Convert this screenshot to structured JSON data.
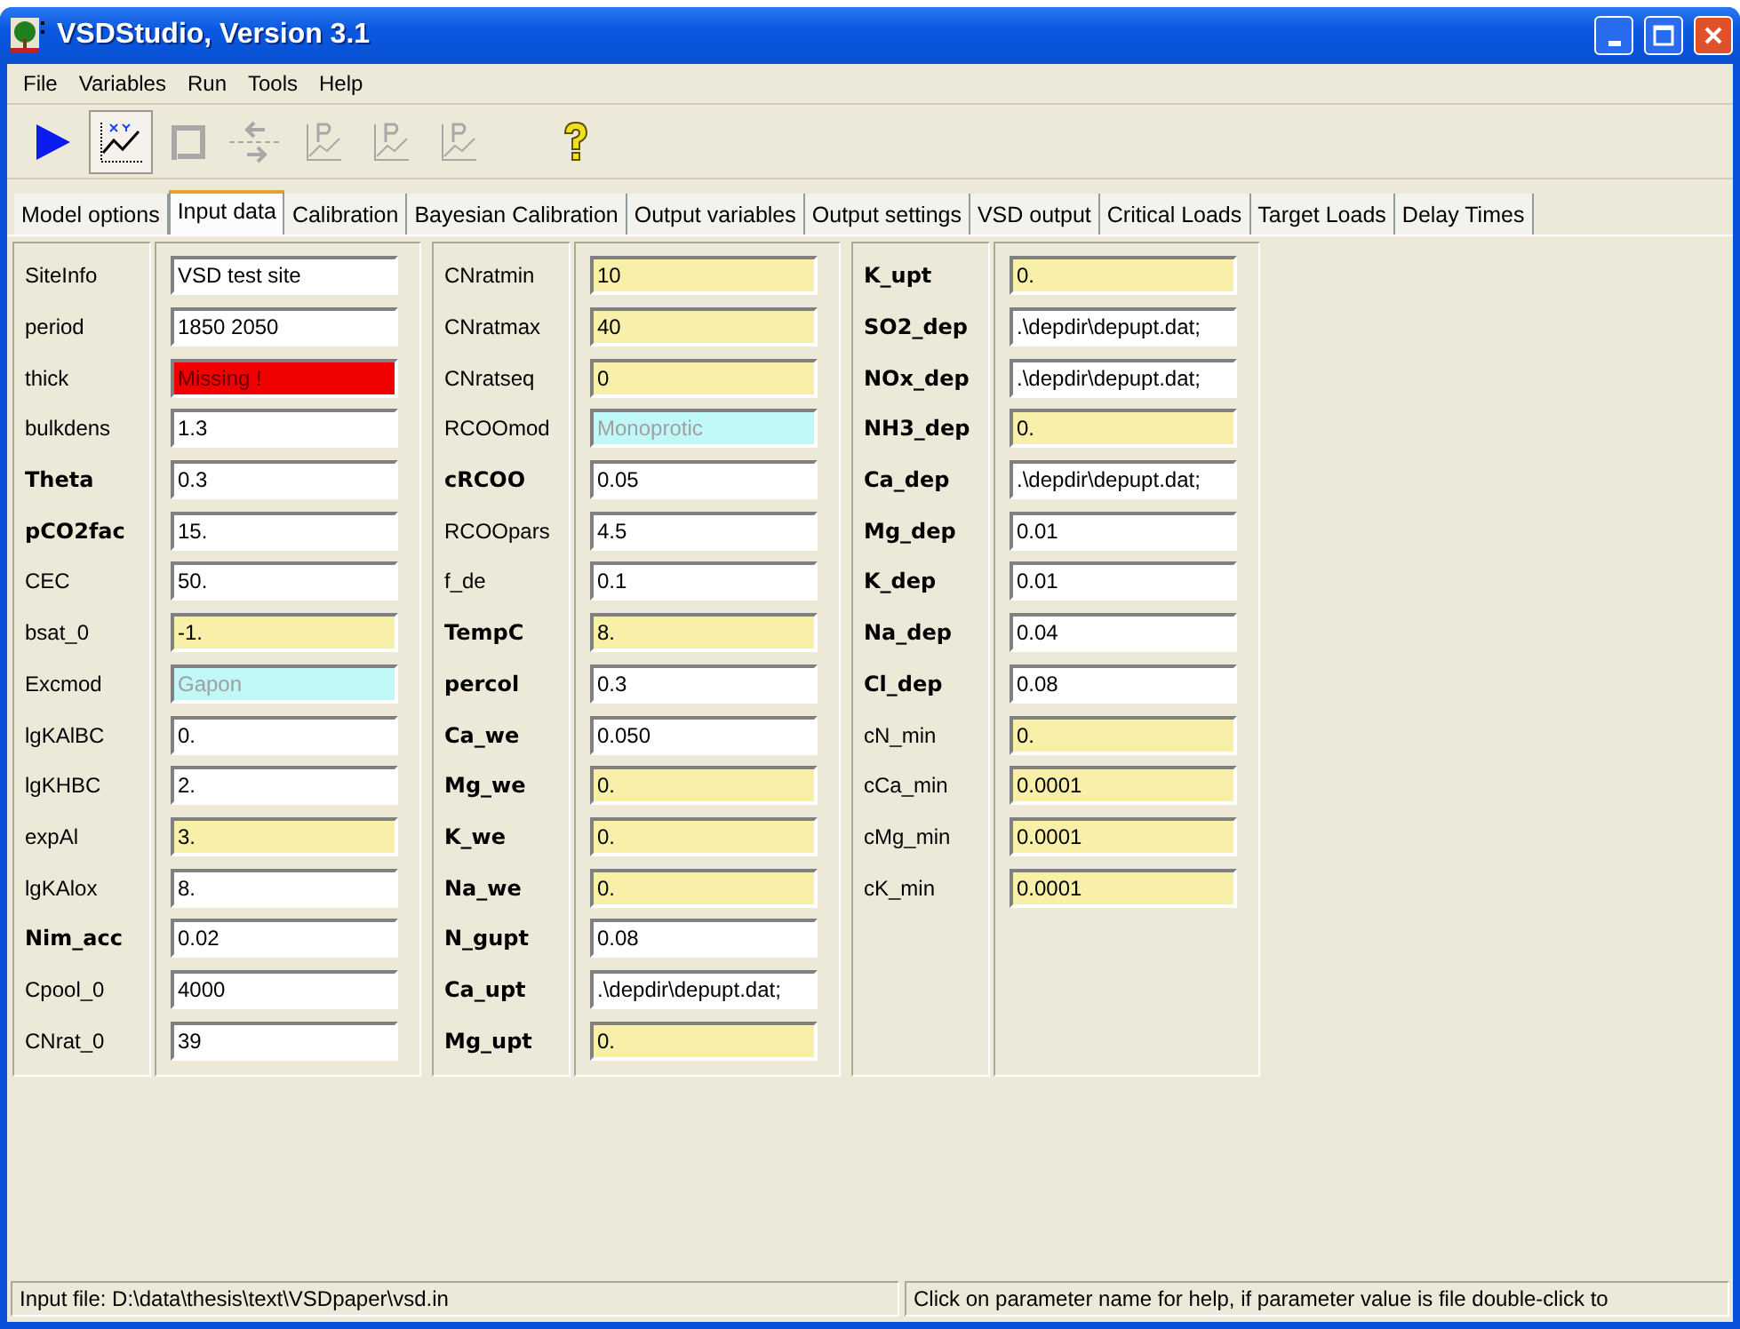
{
  "window": {
    "title": "VSDStudio, Version 3.1"
  },
  "menu": [
    {
      "label": "File"
    },
    {
      "label": "Variables"
    },
    {
      "label": "Run"
    },
    {
      "label": "Tools"
    },
    {
      "label": "Help"
    }
  ],
  "toolbar": [
    {
      "kind": "run",
      "disabled": false,
      "pressed": false
    },
    {
      "kind": "xy-plot",
      "disabled": false,
      "pressed": true
    },
    {
      "kind": "loop",
      "disabled": true,
      "pressed": false
    },
    {
      "kind": "exchange",
      "disabled": true,
      "pressed": false
    },
    {
      "kind": "plot-p",
      "disabled": true,
      "pressed": false
    },
    {
      "kind": "plot-s",
      "disabled": true,
      "pressed": false
    },
    {
      "kind": "plot-c",
      "disabled": true,
      "pressed": false
    },
    {
      "kind": "help",
      "disabled": false,
      "pressed": false
    }
  ],
  "tabs": [
    {
      "label": "Model options",
      "selected": false
    },
    {
      "label": "Input data",
      "selected": true
    },
    {
      "label": "Calibration",
      "selected": false
    },
    {
      "label": "Bayesian Calibration",
      "selected": false
    },
    {
      "label": "Output variables",
      "selected": false
    },
    {
      "label": "Output settings",
      "selected": false
    },
    {
      "label": "VSD output",
      "selected": false
    },
    {
      "label": "Critical Loads",
      "selected": false
    },
    {
      "label": "Target Loads",
      "selected": false
    },
    {
      "label": "Delay Times",
      "selected": false
    }
  ],
  "groups": [
    {
      "rows": [
        {
          "label": "SiteInfo",
          "bold": false,
          "value": "VSD test site",
          "kind": "value"
        },
        {
          "label": "period",
          "bold": false,
          "value": "1850 2050",
          "kind": "value"
        },
        {
          "label": "thick",
          "bold": false,
          "value": "Missing !",
          "kind": "missing"
        },
        {
          "label": "bulkdens",
          "bold": false,
          "value": "1.3",
          "kind": "value"
        },
        {
          "label": "Theta",
          "bold": true,
          "value": "0.3",
          "kind": "value"
        },
        {
          "label": "pCO2fac",
          "bold": true,
          "value": "15.",
          "kind": "value"
        },
        {
          "label": "CEC",
          "bold": false,
          "value": "50.",
          "kind": "value"
        },
        {
          "label": "bsat_0",
          "bold": false,
          "value": "-1.",
          "kind": "default"
        },
        {
          "label": "Excmod",
          "bold": false,
          "value": "Gapon",
          "kind": "fixed"
        },
        {
          "label": "lgKAlBC",
          "bold": false,
          "value": "0.",
          "kind": "value"
        },
        {
          "label": "lgKHBC",
          "bold": false,
          "value": "2.",
          "kind": "value"
        },
        {
          "label": "expAl",
          "bold": false,
          "value": "3.",
          "kind": "default"
        },
        {
          "label": "lgKAlox",
          "bold": false,
          "value": "8.",
          "kind": "value"
        },
        {
          "label": "Nim_acc",
          "bold": true,
          "value": "0.02",
          "kind": "value"
        },
        {
          "label": "Cpool_0",
          "bold": false,
          "value": "4000",
          "kind": "value"
        },
        {
          "label": "CNrat_0",
          "bold": false,
          "value": "39",
          "kind": "value"
        }
      ]
    },
    {
      "rows": [
        {
          "label": "CNratmin",
          "bold": false,
          "value": "10",
          "kind": "default"
        },
        {
          "label": "CNratmax",
          "bold": false,
          "value": "40",
          "kind": "default"
        },
        {
          "label": "CNratseq",
          "bold": false,
          "value": "0",
          "kind": "default"
        },
        {
          "label": "RCOOmod",
          "bold": false,
          "value": "Monoprotic",
          "kind": "fixed"
        },
        {
          "label": "cRCOO",
          "bold": true,
          "value": "0.05",
          "kind": "value"
        },
        {
          "label": "RCOOpars",
          "bold": false,
          "value": "4.5",
          "kind": "value"
        },
        {
          "label": "f_de",
          "bold": false,
          "value": "0.1",
          "kind": "value"
        },
        {
          "label": "TempC",
          "bold": true,
          "value": "8.",
          "kind": "default"
        },
        {
          "label": "percol",
          "bold": true,
          "value": "0.3",
          "kind": "value"
        },
        {
          "label": "Ca_we",
          "bold": true,
          "value": "0.050",
          "kind": "value"
        },
        {
          "label": "Mg_we",
          "bold": true,
          "value": "0.",
          "kind": "default"
        },
        {
          "label": "K_we",
          "bold": true,
          "value": "0.",
          "kind": "default"
        },
        {
          "label": "Na_we",
          "bold": true,
          "value": "0.",
          "kind": "default"
        },
        {
          "label": "N_gupt",
          "bold": true,
          "value": "0.08",
          "kind": "value"
        },
        {
          "label": "Ca_upt",
          "bold": true,
          "value": ".\\depdir\\depupt.dat;",
          "kind": "value"
        },
        {
          "label": "Mg_upt",
          "bold": true,
          "value": "0.",
          "kind": "default"
        }
      ]
    },
    {
      "rows": [
        {
          "label": "K_upt",
          "bold": true,
          "value": "0.",
          "kind": "default"
        },
        {
          "label": "SO2_dep",
          "bold": true,
          "value": ".\\depdir\\depupt.dat;",
          "kind": "value"
        },
        {
          "label": "NOx_dep",
          "bold": true,
          "value": ".\\depdir\\depupt.dat;",
          "kind": "value"
        },
        {
          "label": "NH3_dep",
          "bold": true,
          "value": "0.",
          "kind": "default"
        },
        {
          "label": "Ca_dep",
          "bold": true,
          "value": ".\\depdir\\depupt.dat;",
          "kind": "value"
        },
        {
          "label": "Mg_dep",
          "bold": true,
          "value": "0.01",
          "kind": "value"
        },
        {
          "label": "K_dep",
          "bold": true,
          "value": "0.01",
          "kind": "value"
        },
        {
          "label": "Na_dep",
          "bold": true,
          "value": "0.04",
          "kind": "value"
        },
        {
          "label": "Cl_dep",
          "bold": true,
          "value": "0.08",
          "kind": "value"
        },
        {
          "label": "cN_min",
          "bold": false,
          "value": "0.",
          "kind": "default"
        },
        {
          "label": "cCa_min",
          "bold": false,
          "value": "0.0001",
          "kind": "default"
        },
        {
          "label": "cMg_min",
          "bold": false,
          "value": "0.0001",
          "kind": "default"
        },
        {
          "label": "cK_min",
          "bold": false,
          "value": "0.0001",
          "kind": "default"
        }
      ]
    }
  ],
  "status_bar": {
    "input_file": "Input file: D:\\data\\thesis\\text\\VSDpaper\\vsd.in",
    "hint": "Click on parameter name for help, if parameter value is file double-click to"
  }
}
